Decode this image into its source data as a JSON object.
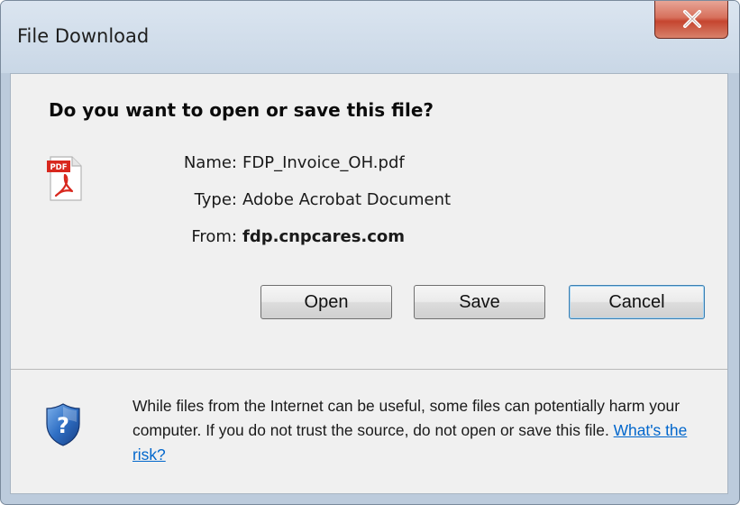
{
  "window": {
    "title": "File Download"
  },
  "dialog": {
    "question": "Do you want to open or save this file?",
    "file_icon": "pdf-file-icon",
    "fields": [
      {
        "label": "Name:",
        "value": "FDP_Invoice_OH.pdf"
      },
      {
        "label": "Type:",
        "value": "Adobe Acrobat Document"
      },
      {
        "label": "From:",
        "value": "fdp.cnpcares.com"
      }
    ],
    "buttons": {
      "open": "Open",
      "save": "Save",
      "cancel": "Cancel"
    },
    "warning": {
      "icon": "security-shield-question-icon",
      "text": "While files from the Internet can be useful, some files can potentially harm your computer. If you do not trust the source, do not open or save this file.",
      "link": "What's the risk?"
    }
  },
  "colors": {
    "link": "#0066cc",
    "close_button": "#c5452f",
    "title_bar": "#c9d7e6"
  }
}
